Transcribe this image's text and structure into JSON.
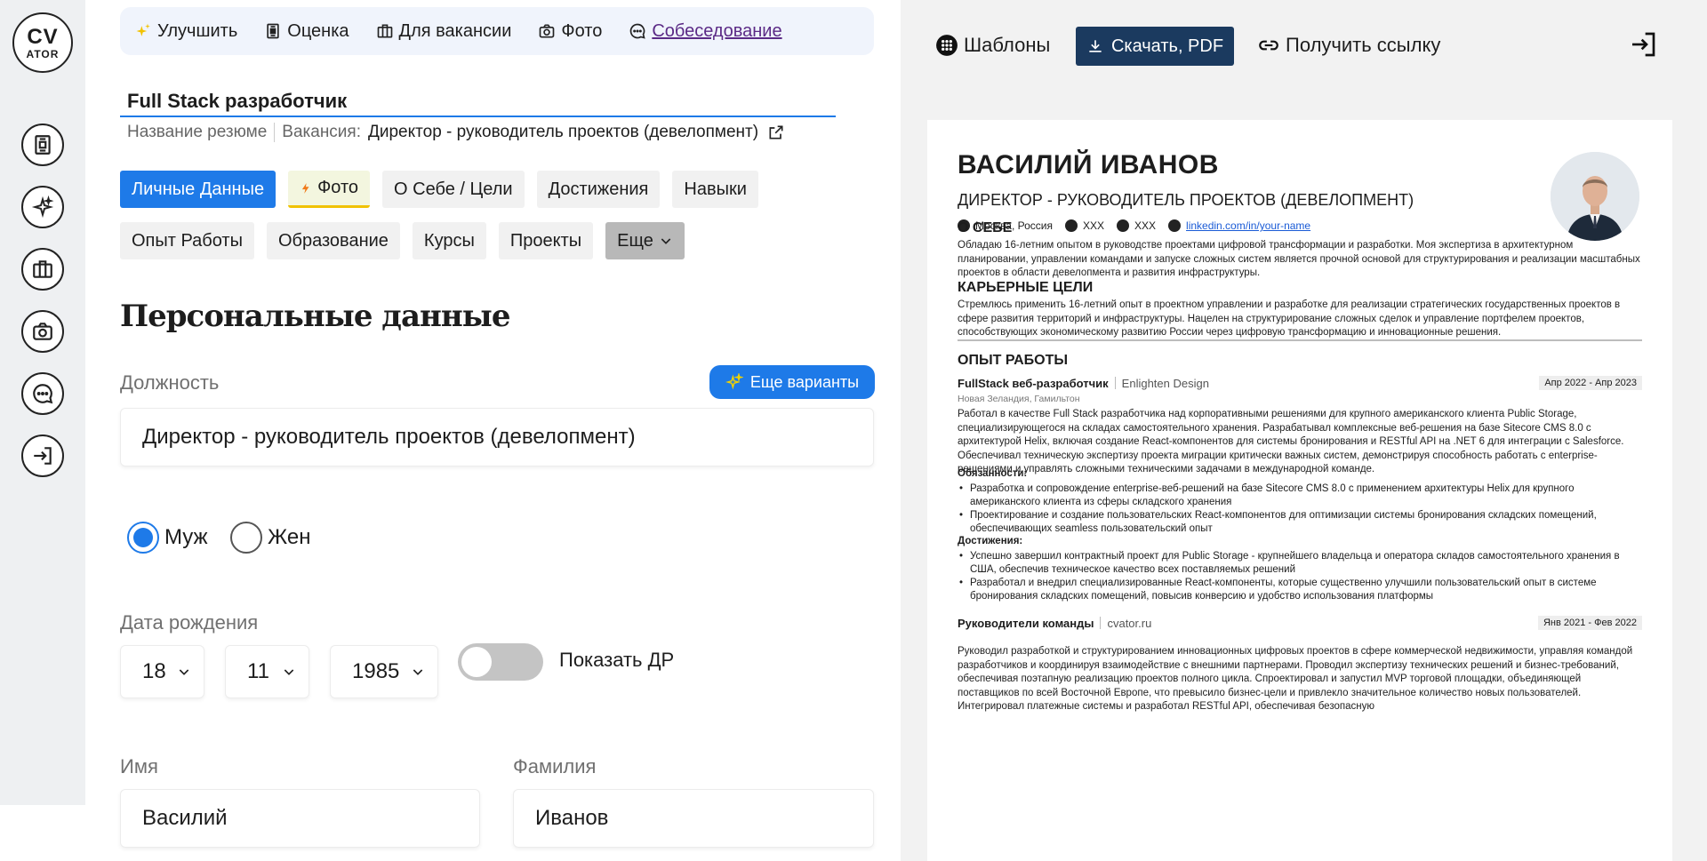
{
  "logo": {
    "line1": "CV",
    "line2": "ATOR"
  },
  "rail": {
    "icons": [
      "resume-icon",
      "sparkle-icon",
      "briefcase-icon",
      "camera-icon",
      "chat-icon",
      "exit-icon"
    ]
  },
  "tabs": [
    "Улучшить",
    "Оценка",
    "Для вакансии",
    "Фото",
    "Собеседование"
  ],
  "resume": {
    "title": "Full Stack разработчик",
    "name_label": "Название резюме",
    "vacancy_label": "Вакансия:",
    "vacancy_value": "Директор - руководитель проектов (девелопмент)"
  },
  "sections": [
    "Личные Данные",
    "Фото",
    "О Себе / Цели",
    "Достижения",
    "Навыки",
    "Опыт Работы",
    "Образование",
    "Курсы",
    "Проекты",
    "Еще"
  ],
  "form": {
    "heading": "Персональные данные",
    "position_label": "Должность",
    "more_options": "Еще варианты",
    "position_value": "Директор - руководитель проектов (девелопмент)",
    "gender": {
      "male": "Муж",
      "female": "Жен",
      "selected": "male"
    },
    "birth_label": "Дата рождения",
    "birth_day": "18",
    "birth_month": "11",
    "birth_year": "1985",
    "show_birthday": "Показать ДР",
    "show_birthday_on": false,
    "first_name_label": "Имя",
    "first_name": "Василий",
    "last_name_label": "Фамилия",
    "last_name": "Иванов"
  },
  "toolbar": {
    "templates": "Шаблоны",
    "download": "Скачать, PDF",
    "get_link": "Получить ссылку"
  },
  "preview": {
    "name": "ВАСИЛИЙ ИВАНОВ",
    "role": "ДИРЕКТОР - РУКОВОДИТЕЛЬ ПРОЕКТОВ (ДЕВЕЛОПМЕНТ)",
    "location": "Москва, Россия",
    "phone": "XXX",
    "email": "XXX",
    "linkedin": "linkedin.com/in/your-name",
    "about_h": "О СЕБЕ",
    "about": "Обладаю 16-летним опытом в руководстве проектами цифровой трансформации и разработки. Моя экспертиза в архитектурном планировании, управлении командами и запуске сложных систем является прочной основой для структурирования и реализации масштабных проектов в области девелопмента и развития инфраструктуры.",
    "goals_h": "КАРЬЕРНЫЕ ЦЕЛИ",
    "goals": "Стремлюсь применить 16-летний опыт в проектном управлении и разработке для реализации стратегических государственных проектов в сфере развития территорий и инфраструктуры. Нацелен на структурирование сложных сделок и управление портфелем проектов, способствующих экономическому развитию России через цифровую трансформацию и инновационные решения.",
    "exp_h": "ОПЫТ РАБОТЫ",
    "job1": {
      "position": "FullStack веб-разработчик",
      "company": "Enlighten Design",
      "dates": "Апр 2022 - Апр 2023",
      "location": "Новая Зеландия, Гамильтон",
      "desc": "Работал в качестве Full Stack разработчика над корпоративными решениями для крупного американского клиента Public Storage, специализирующегося на складах самостоятельного хранения. Разрабатывал комплексные веб-решения на базе Sitecore CMS 8.0 с архитектурой Helix, включая создание React-компонентов для системы бронирования и RESTful API на .NET 6 для интеграции с Salesforce. Обеспечивал техническую экспертизу проекта миграции критически важных систем, демонстрируя способность работать с enterprise-решениями и управлять сложными техническими задачами в международной команде.",
      "duties_h": "Обязанности:",
      "duties": [
        "Разработка и сопровождение enterprise-веб-решений на базе Sitecore CMS 8.0 с применением архитектуры Helix для крупного американского клиента из сферы складского хранения",
        "Проектирование и создание пользовательских React-компонентов для оптимизации системы бронирования складских помещений, обеспечивающих seamless пользовательский опыт"
      ],
      "achievements_h": "Достижения:",
      "achievements": [
        "Успешно завершил контрактный проект для Public Storage - крупнейшего владельца и оператора складов самостоятельного хранения в США, обеспечив техническое качество всех поставляемых решений",
        "Разработал и внедрил специализированные React-компоненты, которые существенно улучшили пользовательский опыт в системе бронирования складских помещений, повысив конверсию и удобство использования платформы"
      ]
    },
    "job2": {
      "position": "Руководители команды",
      "company": "cvator.ru",
      "dates": "Янв 2021 - Фев 2022",
      "desc": "Руководил разработкой и структурированием инновационных цифровых проектов в сфере коммерческой недвижимости, управляя командой разработчиков и координируя взаимодействие с внешними партнерами. Проводил экспертизу технических решений и бизнес-требований, обеспечивая поэтапную реализацию проектов полного цикла. Спроектировал и запустил MVP торговой площадки, объединяющей поставщиков по всей Восточной Европе, что превысило бизнес-цели и привлекло значительное количество новых пользователей. Интегрировал платежные системы и разработал RESTful API, обеспечивая безопасную"
    }
  }
}
